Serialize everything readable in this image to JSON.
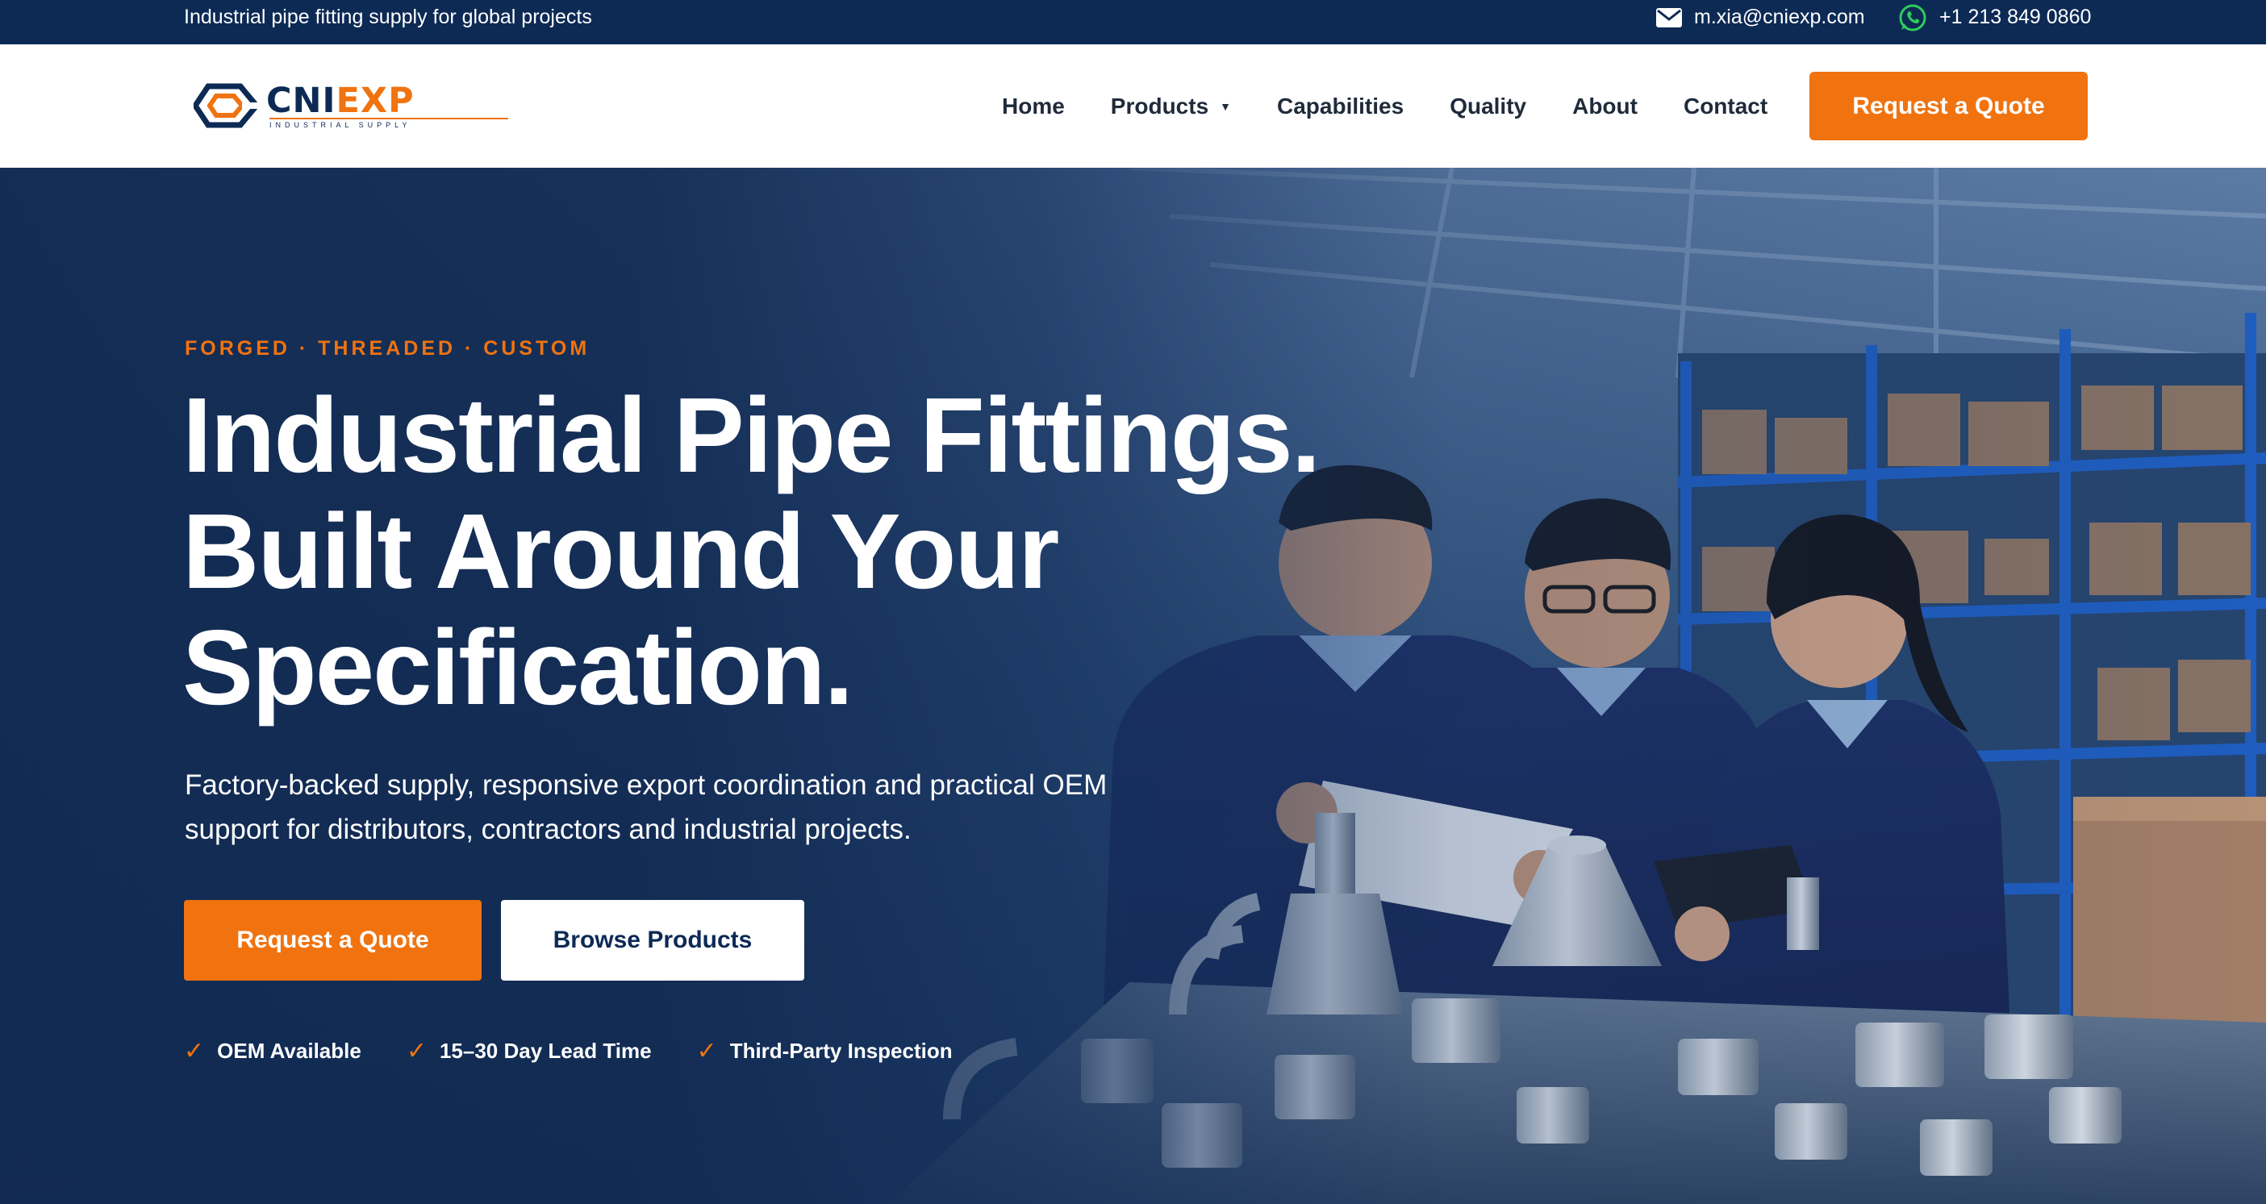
{
  "topbar": {
    "tagline": "Industrial pipe fitting supply for global projects",
    "email": "m.xia@cniexp.com",
    "phone": "+1 213 849 0860",
    "email_icon": "mail-icon",
    "phone_icon": "whatsapp-icon"
  },
  "logo": {
    "part1": "CNI",
    "part2": "EXP",
    "subtitle": "INDUSTRIAL SUPPLY"
  },
  "nav": {
    "items": [
      {
        "label": "Home"
      },
      {
        "label": "Products",
        "has_dropdown": true
      },
      {
        "label": "Capabilities"
      },
      {
        "label": "Quality"
      },
      {
        "label": "About"
      },
      {
        "label": "Contact"
      }
    ],
    "cta": "Request a Quote"
  },
  "hero": {
    "eyebrow": "FORGED · THREADED · CUSTOM",
    "headline_lines": [
      "Industrial Pipe Fittings.",
      "Built Around Your",
      "Specification."
    ],
    "subtext": "Factory-backed supply, responsive export coordination and practical OEM support for distributors, contractors and industrial projects.",
    "primary_button": "Request a Quote",
    "secondary_button": "Browse Products",
    "features": [
      "OEM Available",
      "15–30 Day Lead Time",
      "Third-Party Inspection"
    ],
    "check_glyph": "✓"
  },
  "colors": {
    "navy": "#0d2a55",
    "accent": "#f07310",
    "white": "#ffffff"
  }
}
